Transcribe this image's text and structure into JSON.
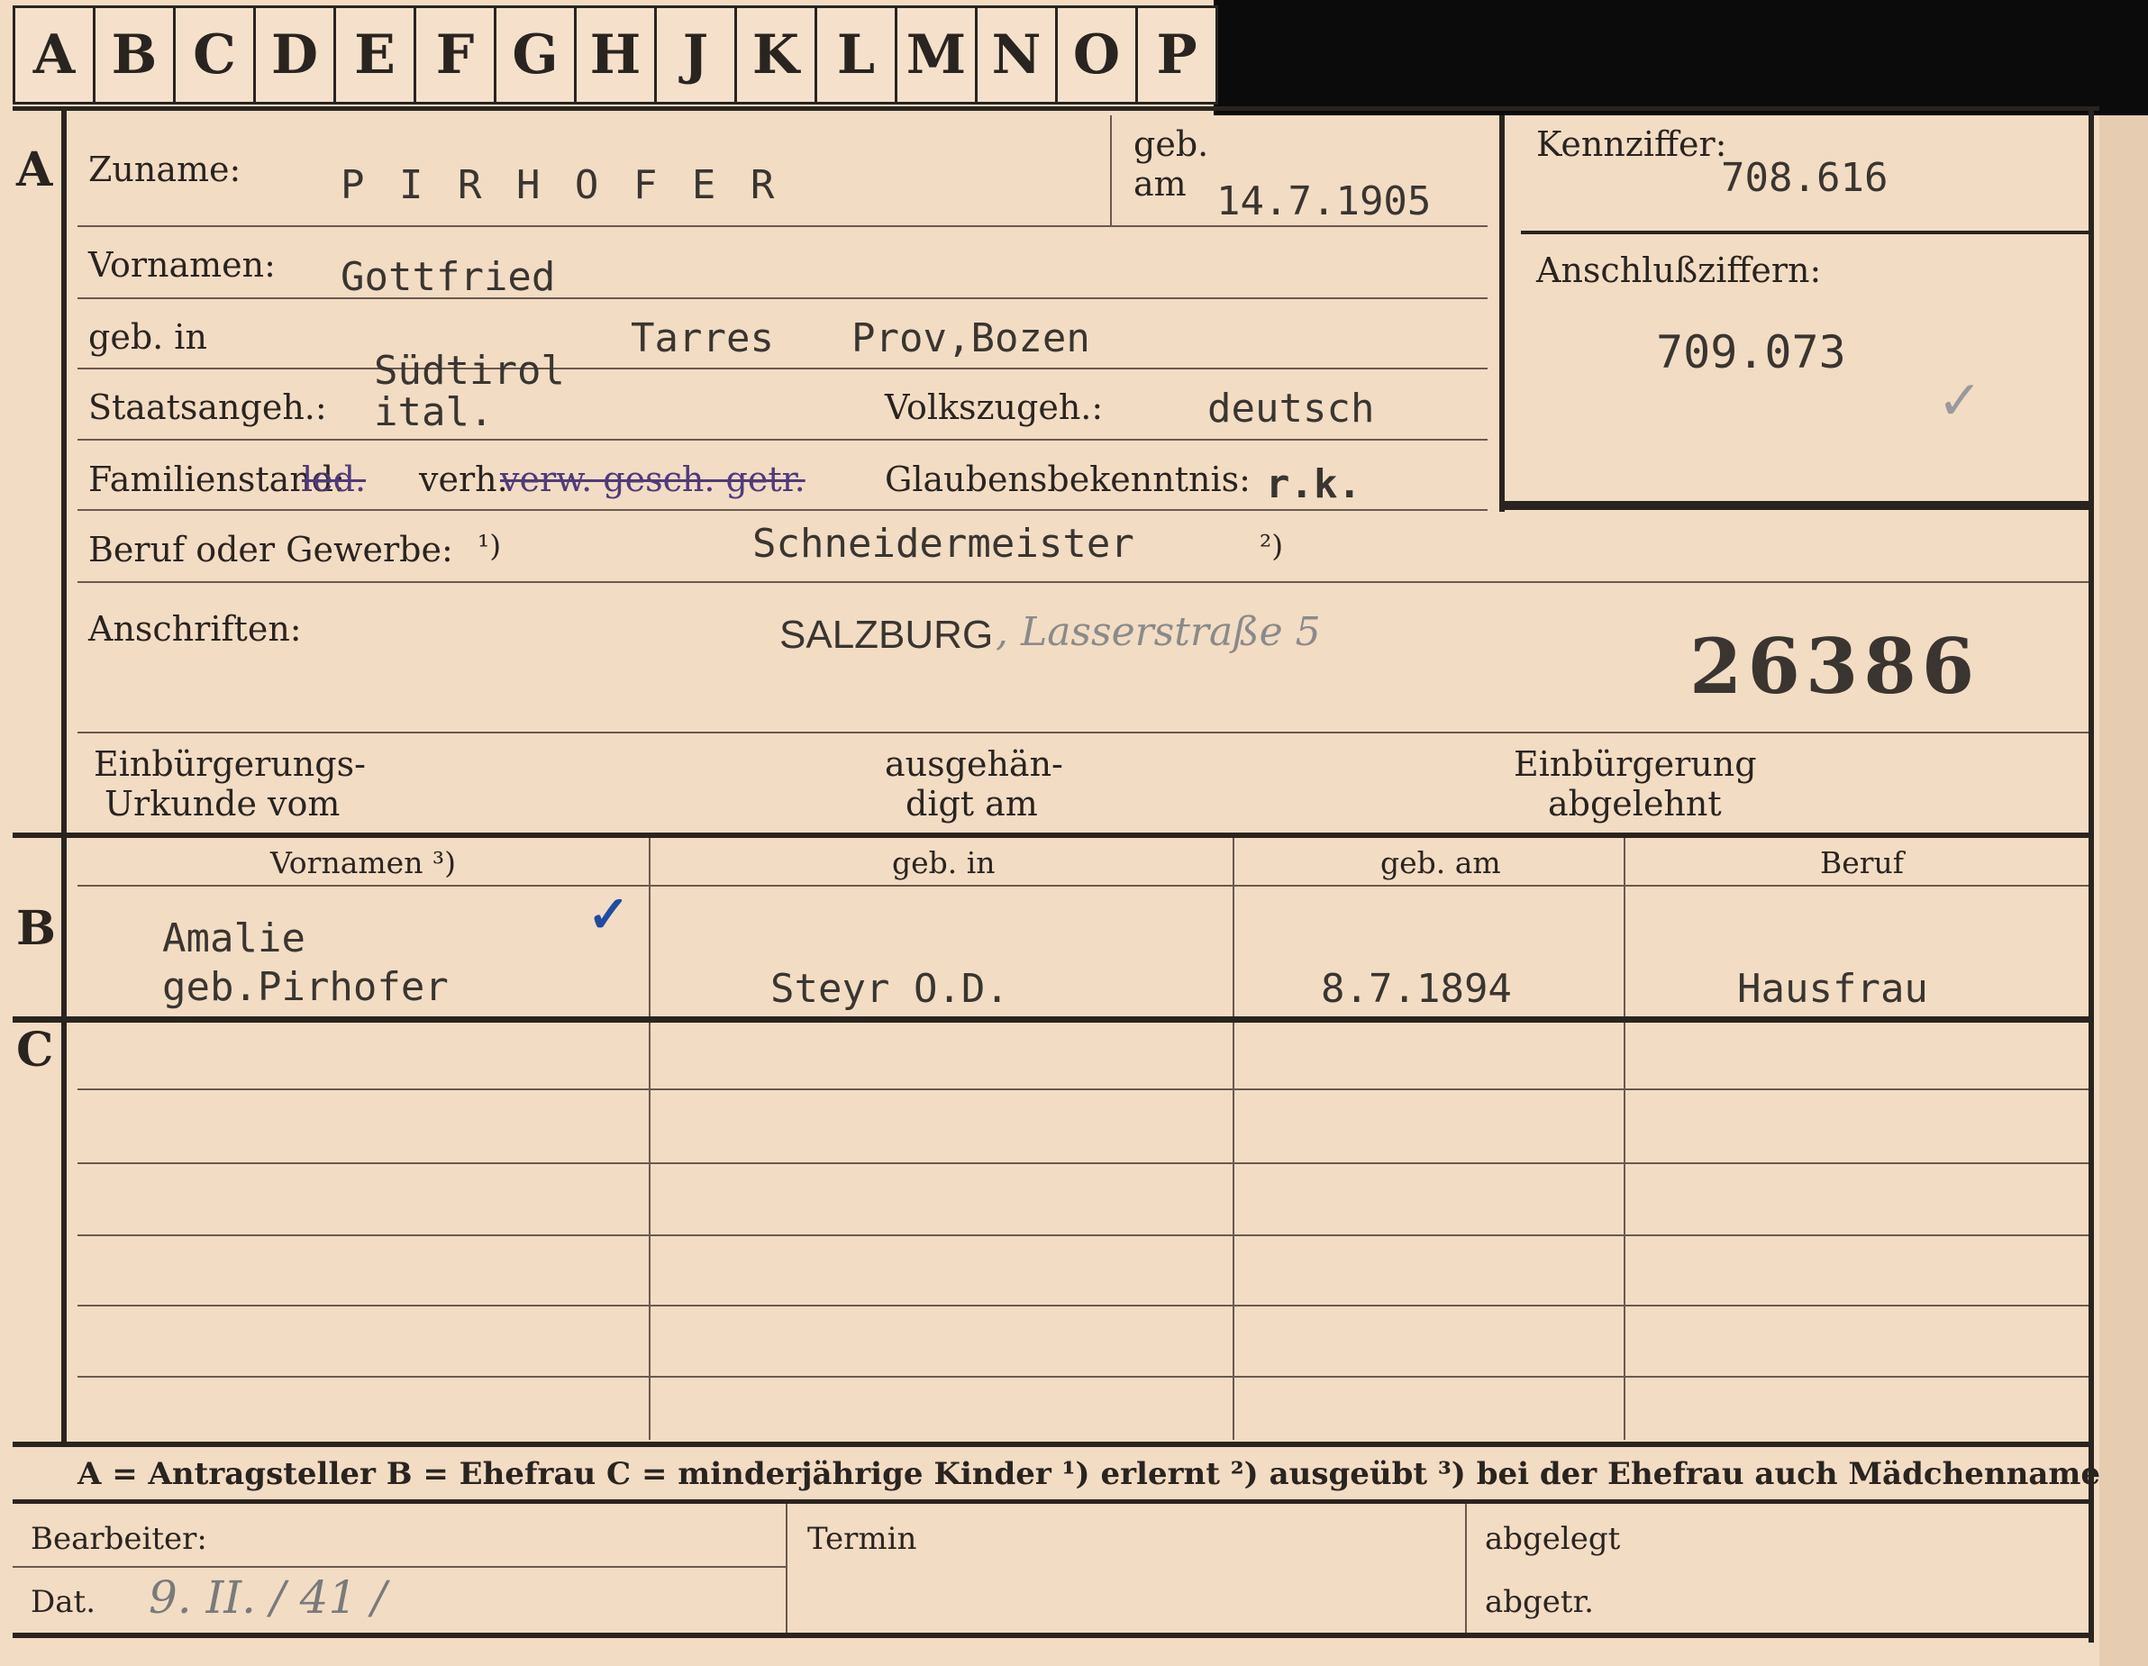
{
  "index_tabs": [
    "A",
    "B",
    "C",
    "D",
    "E",
    "F",
    "G",
    "H",
    "J",
    "K",
    "L",
    "M",
    "N",
    "O",
    "P"
  ],
  "sections": {
    "a": "A",
    "b": "B",
    "c": "C"
  },
  "applicant": {
    "surname_label": "Zuname:",
    "surname": "P I R H O F E R",
    "born_on_label_1": "geb.",
    "born_on_label_2": "am",
    "born_on": "14.7.1905",
    "given_names_label": "Vornamen:",
    "given_names": "Gottfried",
    "born_in_label": "geb. in",
    "born_in_region": "Südtirol",
    "born_in_place": "Tarres",
    "born_in_province": "Prov,Bozen",
    "citizenship_label": "Staatsangeh.:",
    "citizenship": "ital.",
    "ethnicity_label": "Volkszugeh.:",
    "ethnicity": "deutsch",
    "marital_label": "Familienstand:",
    "marital_struck_1": "led.",
    "marital_active": "verh.",
    "marital_struck_2": "verw. gesch. getr.",
    "religion_label": "Glaubensbekenntnis:",
    "religion": "r.k.",
    "occupation_label": "Beruf oder Gewerbe:",
    "footnote_1": "¹)",
    "footnote_2": "²)",
    "occupation": "Schneidermeister",
    "address_label": "Anschriften:",
    "address_city": "SALZBURG",
    "address_street": ", Lasserstraße 5",
    "file_number": "26386",
    "naturalization_doc_label_1": "Einbürgerungs-",
    "naturalization_doc_label_2": "Urkunde vom",
    "handed_out_label_1": "ausgehän-",
    "handed_out_label_2": "digt am",
    "refused_label_1": "Einbürgerung",
    "refused_label_2": "abgelehnt"
  },
  "codes": {
    "id_label": "Kennziffer:",
    "id": "708.616",
    "connection_label": "Anschlußziffern:",
    "connection": "709.073",
    "check": "✓"
  },
  "family_table": {
    "headers": [
      "Vornamen ³)",
      "geb. in",
      "geb. am",
      "Beruf"
    ],
    "spouse": {
      "name_line_1": "Amalie",
      "name_line_2": "geb.Pirhofer",
      "born_in": "Steyr  O.D.",
      "born_on": "8.7.1894",
      "occupation": "Hausfrau",
      "check": "✓"
    }
  },
  "legend": "A = Antragsteller   B = Ehefrau   C = minderjährige Kinder   ¹) erlernt   ²) ausgeübt   ³) bei der Ehefrau auch Mädchenname",
  "footer": {
    "clerk_label": "Bearbeiter:",
    "date_label": "Dat.",
    "date_value": "9. II. / 41 /",
    "deadline_label": "Termin",
    "filed_label": "abgelegt",
    "dispatched_label": "abgetr."
  }
}
